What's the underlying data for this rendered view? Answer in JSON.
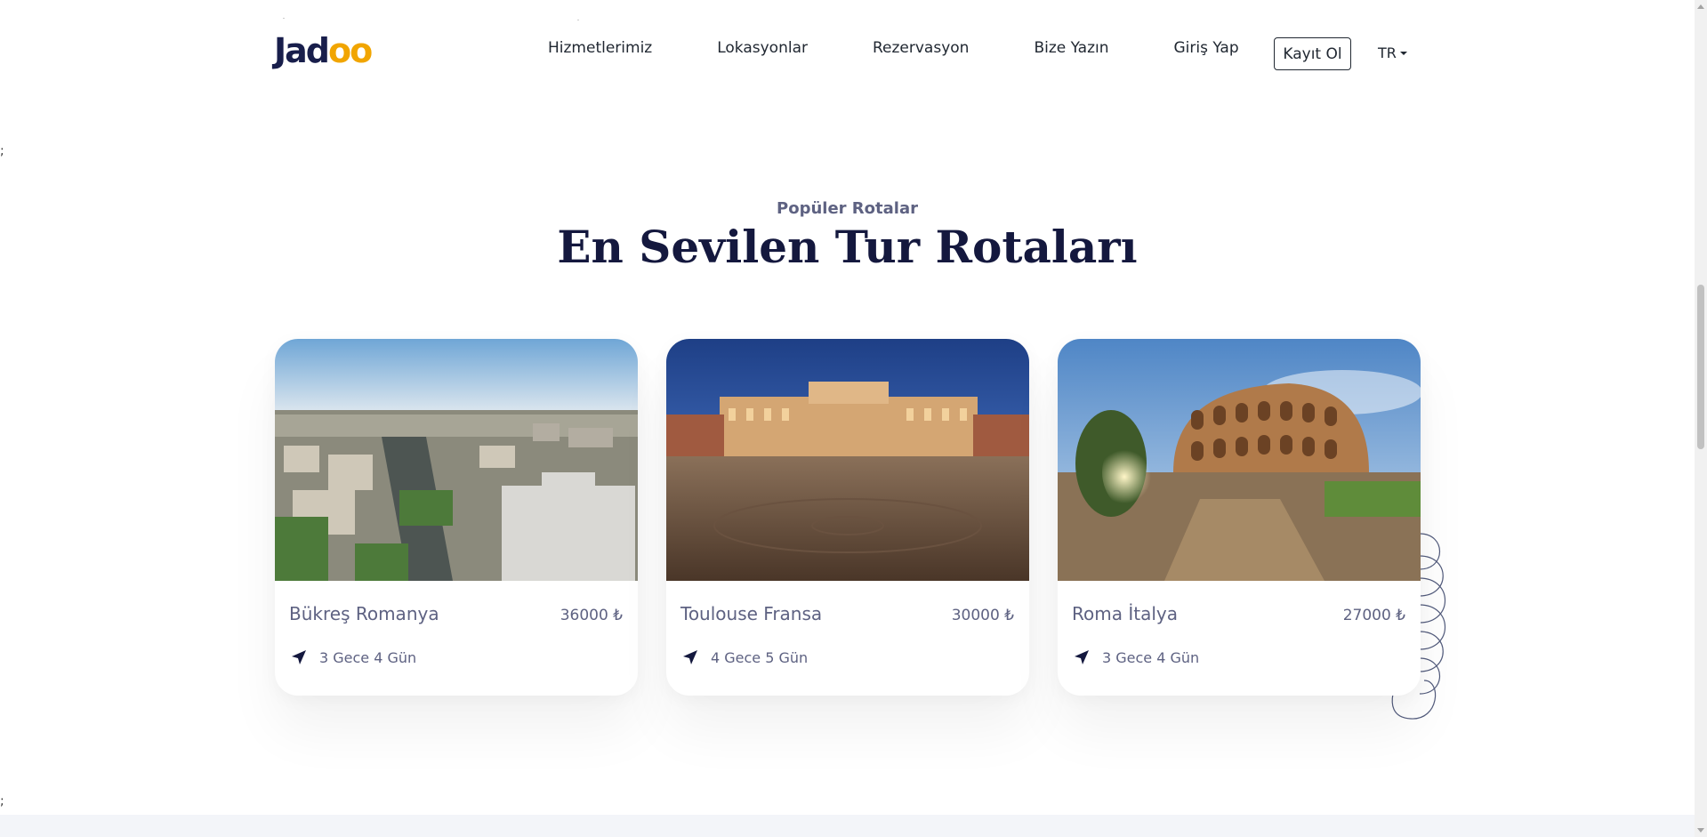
{
  "header": {
    "logo_text": "Jad",
    "logo_accent": "oo",
    "nav": [
      "Hizmetlerimiz",
      "Lokasyonlar",
      "Rezervasyon",
      "Bize Yazın",
      "Giriş Yap"
    ],
    "signup_label": "Kayıt Ol",
    "language": "TR"
  },
  "stray": {
    "semicolon_top": ";",
    "semicolon_bottom": ";"
  },
  "section": {
    "subtitle": "Popüler Rotalar",
    "title": "En Sevilen Tur Rotaları"
  },
  "tours": [
    {
      "name": "Bükreş Romanya",
      "price": "36000 ₺",
      "duration": "3 Gece 4 Gün",
      "image": "bucharest-aerial-photo"
    },
    {
      "name": "Toulouse Fransa",
      "price": "30000 ₺",
      "duration": "4 Gece 5 Gün",
      "image": "toulouse-capitole-photo"
    },
    {
      "name": "Roma İtalya",
      "price": "27000 ₺",
      "duration": "3 Gece 4 Gün",
      "image": "rome-colosseum-photo"
    }
  ],
  "colors": {
    "title": "#14183e",
    "text_muted": "#5e6282",
    "logo_accent": "#f1a501",
    "band": "#f3f5f9"
  }
}
